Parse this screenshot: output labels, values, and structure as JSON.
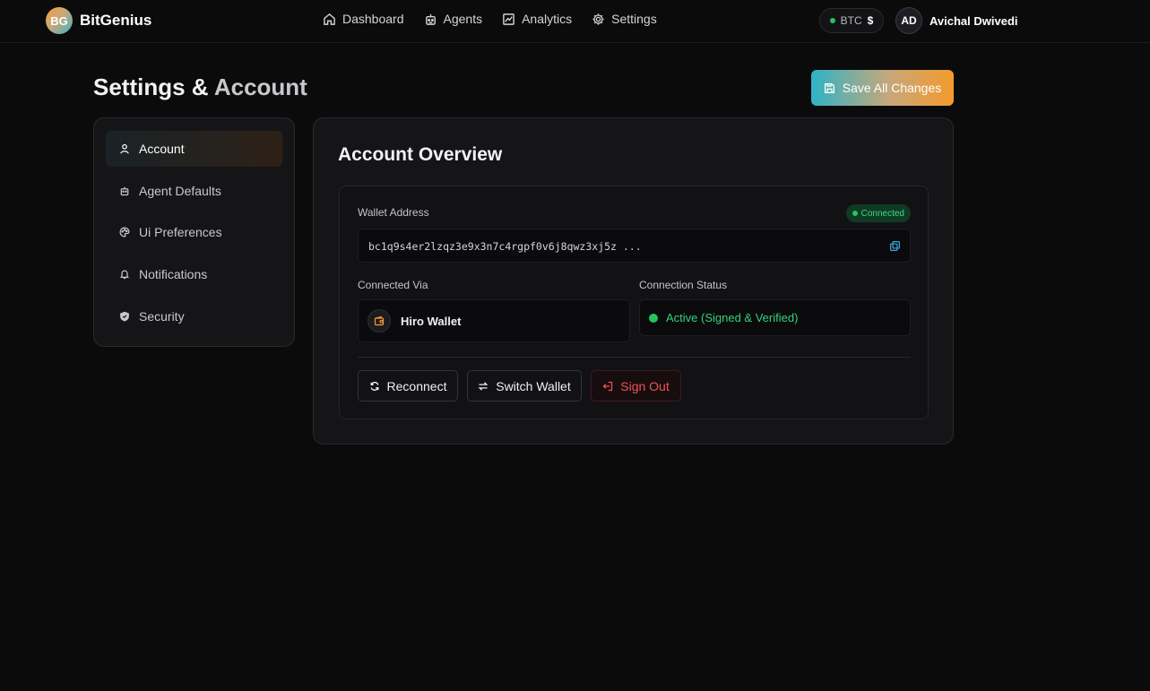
{
  "brand": {
    "logo_text": "BG",
    "name": "BitGenius"
  },
  "nav": {
    "items": [
      {
        "label": "Dashboard",
        "icon": "home-icon"
      },
      {
        "label": "Agents",
        "icon": "robot-icon"
      },
      {
        "label": "Analytics",
        "icon": "chart-icon"
      },
      {
        "label": "Settings",
        "icon": "gear-icon"
      }
    ]
  },
  "ticker": {
    "label": "BTC",
    "value": "$"
  },
  "user": {
    "initials": "AD",
    "name": "Avichal Dwivedi"
  },
  "page": {
    "title_part1": "Settings &",
    "title_part2": "Account",
    "save_label": "Save All Changes"
  },
  "sidebar": {
    "items": [
      {
        "label": "Account",
        "icon": "user-icon",
        "active": true
      },
      {
        "label": "Agent Defaults",
        "icon": "robot-icon"
      },
      {
        "label": "Ui Preferences",
        "icon": "palette-icon"
      },
      {
        "label": "Notifications",
        "icon": "bell-icon"
      },
      {
        "label": "Security",
        "icon": "shield-icon"
      }
    ]
  },
  "account": {
    "title": "Account Overview",
    "wallet_label": "Wallet Address",
    "badge": "Connected",
    "address": "bc1q9s4er2lzqz3e9x3n7c4rgpf0v6j8qwz3xj5z ...",
    "via_label": "Connected Via",
    "via_value": "Hiro Wallet",
    "status_label": "Connection Status",
    "status_value": "Active (Signed & Verified)",
    "buttons": {
      "reconnect": "Reconnect",
      "switch": "Switch Wallet",
      "signout": "Sign Out"
    }
  },
  "colors": {
    "accent_teal": "#2fb3c6",
    "accent_orange": "#f49a2c",
    "success": "#22c55e",
    "danger": "#f05252",
    "background": "#0b0b0c",
    "card": "#151518"
  }
}
